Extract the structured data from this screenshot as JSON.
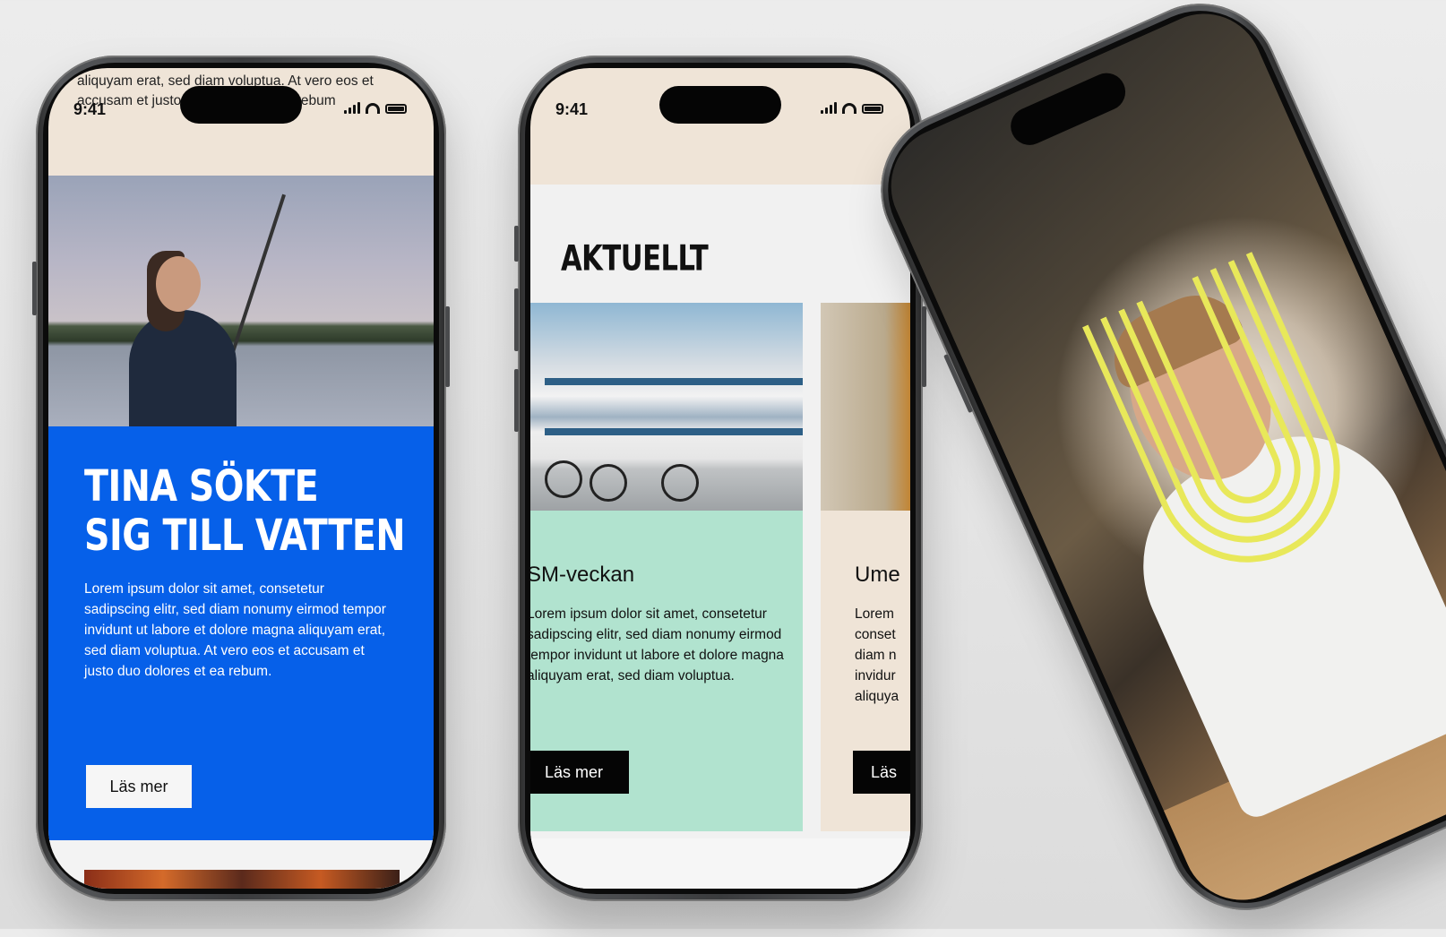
{
  "phone1": {
    "status_time": "9:41",
    "top_snippet": "aliquyam erat, sed diam voluptua. At vero eos et accusam et justo duo dolores et ea rebum",
    "hero_title_line1": "TINA SÖKTE",
    "hero_title_line2": "SIG TILL VATTEN",
    "hero_body": "Lorem ipsum dolor sit amet, consetetur sadipscing elitr, sed diam nonumy eirmod tempor invidunt ut labore et dolore magna aliquyam erat, sed diam voluptua. At vero eos et accusam et justo duo dolores et ea rebum.",
    "cta_label": "Läs mer"
  },
  "phone2": {
    "status_time": "9:41",
    "section_title": "AKTUELLT",
    "cards": [
      {
        "title": "SM-veckan",
        "body": "Lorem ipsum dolor sit amet, consetetur sadipscing elitr, sed diam nonumy eirmod tempor invidunt ut labore et dolore magna aliquyam erat, sed diam voluptua.",
        "cta_label": "Läs mer",
        "bg": "#b1e3cf"
      },
      {
        "title": "Ume",
        "body_lines": [
          "Lorem",
          "conset",
          "diam n",
          "invidur",
          "aliquya"
        ],
        "cta_label": "Läs",
        "bg": "#efe4d7"
      }
    ]
  },
  "phone3": {
    "logo_color": "#e8e85a"
  },
  "colors": {
    "hero_blue": "#0660e9",
    "beige": "#efe4d7",
    "mint": "#b1e3cf"
  }
}
